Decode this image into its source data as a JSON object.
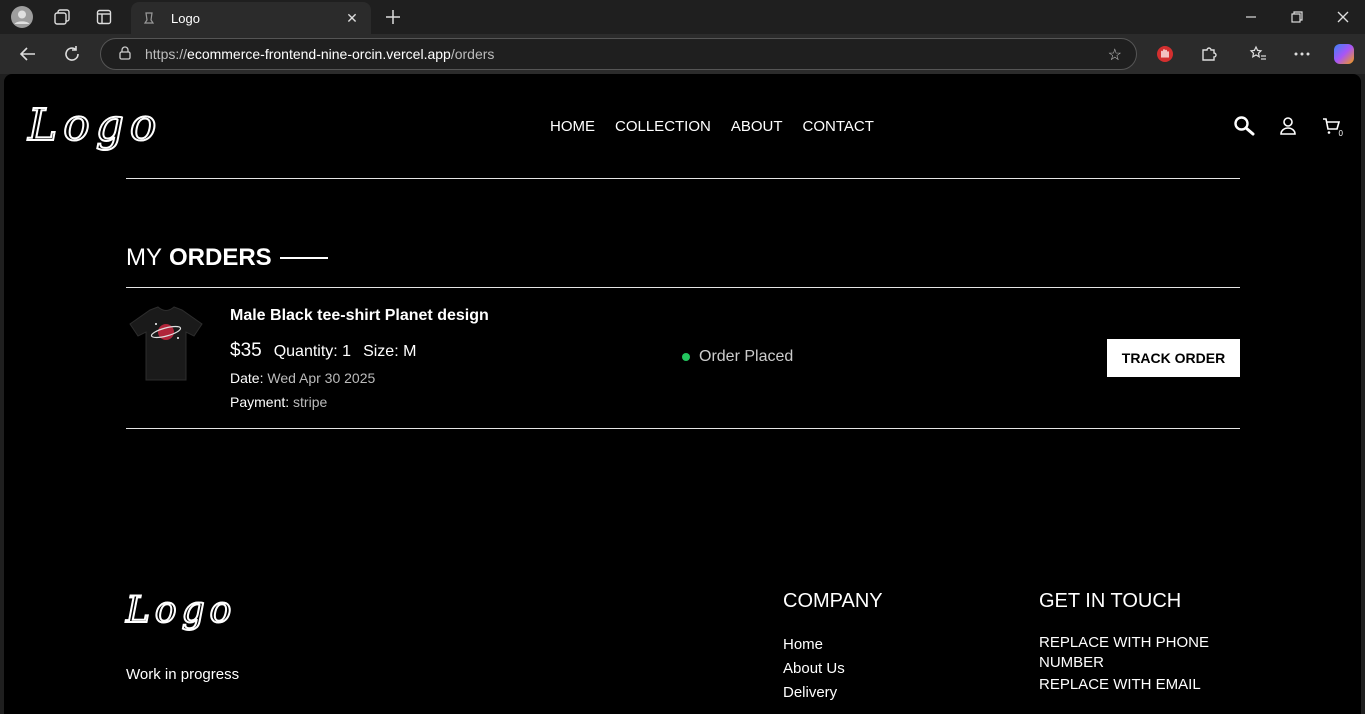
{
  "browser": {
    "tab_title": "Logo",
    "url_scheme": "https://",
    "url_host": "ecommerce-frontend-nine-orcin.vercel.app",
    "url_path": "/orders"
  },
  "header": {
    "logo_text": "Logo",
    "nav": [
      "HOME",
      "COLLECTION",
      "ABOUT",
      "CONTACT"
    ],
    "cart_count": "0"
  },
  "orders": {
    "title_light": "MY",
    "title_bold": "ORDERS",
    "items": [
      {
        "name": "Male Black tee-shirt Planet design",
        "price": "$35",
        "quantity": "Quantity: 1",
        "size": "Size: M",
        "date_label": "Date:",
        "date": "Wed Apr 30 2025",
        "payment_label": "Payment:",
        "payment": "stripe",
        "status": "Order Placed",
        "action": "TRACK ORDER"
      }
    ]
  },
  "footer": {
    "logo_text": "Logo",
    "tagline": "Work in progress",
    "company_title": "COMPANY",
    "company_links": [
      "Home",
      "About Us",
      "Delivery"
    ],
    "contact_title": "GET IN TOUCH",
    "contact_phone": "REPLACE WITH PHONE NUMBER",
    "contact_email": "REPLACE WITH EMAIL"
  },
  "colors": {
    "status_green": "#22c55e",
    "page_bg": "#000000"
  }
}
